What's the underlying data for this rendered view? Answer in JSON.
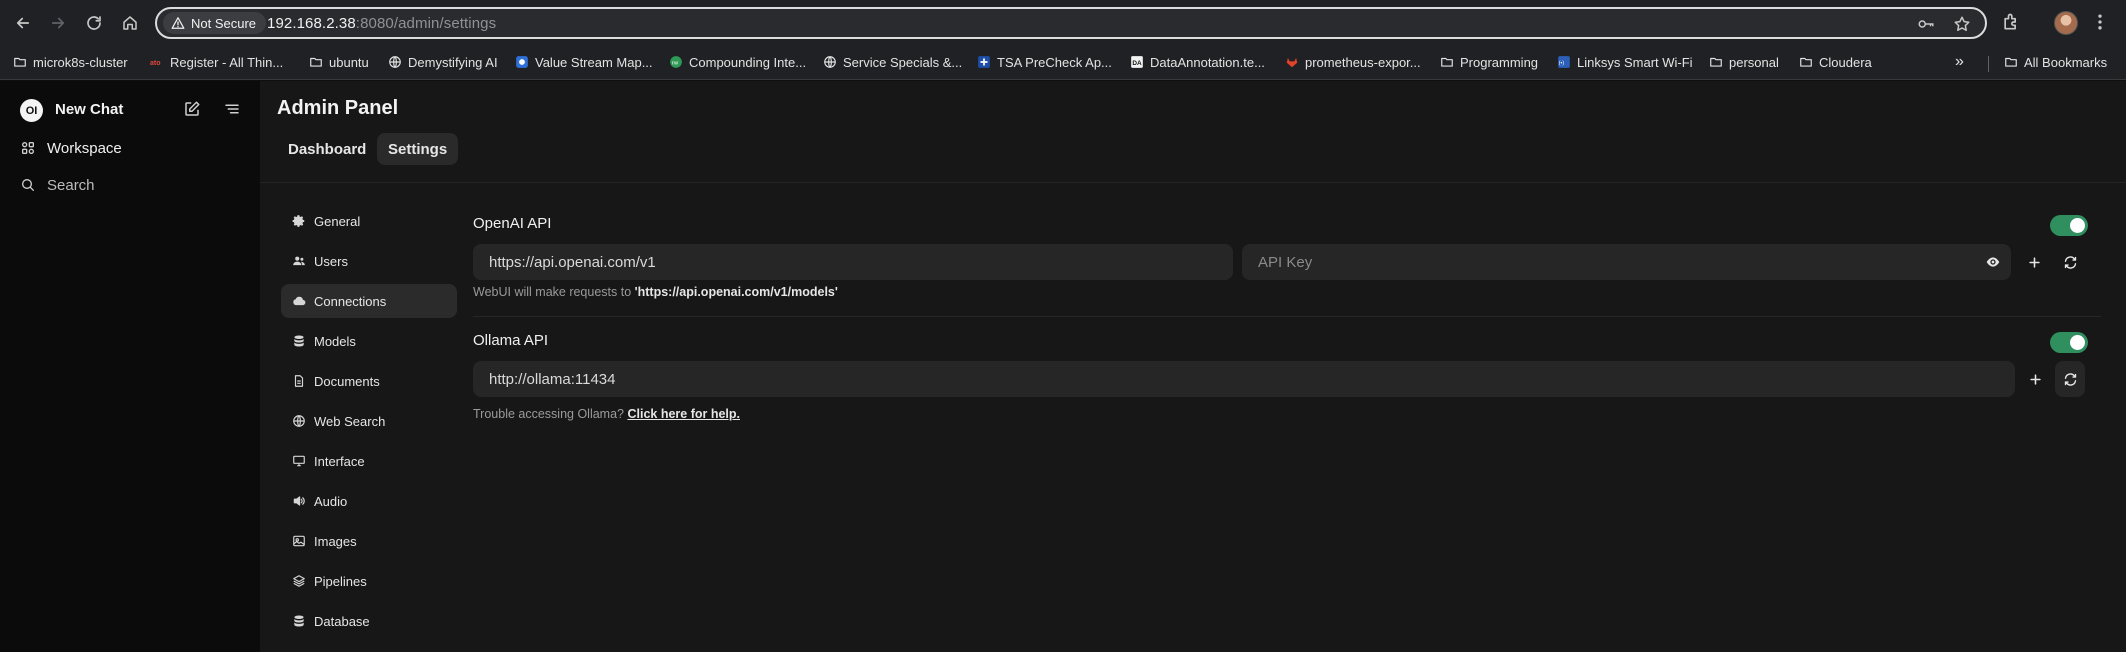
{
  "browser": {
    "security_label": "Not Secure",
    "url_host": "192.168.2.38",
    "url_rest": ":8080/admin/settings",
    "bookmarks": [
      {
        "label": "microk8s-cluster",
        "icon": "folder-icon"
      },
      {
        "label": "Register - All Thin...",
        "icon": "site-icon"
      },
      {
        "label": "ubuntu",
        "icon": "folder-icon"
      },
      {
        "label": "Demystifying AI",
        "icon": "globe-icon"
      },
      {
        "label": "Value Stream Map...",
        "icon": "site-icon"
      },
      {
        "label": "Compounding Inte...",
        "icon": "site-icon"
      },
      {
        "label": "Service Specials &...",
        "icon": "globe-icon"
      },
      {
        "label": "TSA PreCheck Ap...",
        "icon": "site-icon"
      },
      {
        "label": "DataAnnotation.te...",
        "icon": "site-icon"
      },
      {
        "label": "prometheus-expor...",
        "icon": "gitlab-icon"
      },
      {
        "label": "Programming",
        "icon": "folder-icon"
      },
      {
        "label": "Linksys Smart Wi-Fi",
        "icon": "site-icon"
      },
      {
        "label": "personal",
        "icon": "folder-icon"
      },
      {
        "label": "Cloudera",
        "icon": "folder-icon"
      }
    ],
    "more_label": "»",
    "all_bookmarks_label": "All Bookmarks"
  },
  "sidebar": {
    "logo_text": "OI",
    "new_chat_label": "New Chat",
    "workspace_label": "Workspace",
    "search_label": "Search"
  },
  "header": {
    "title": "Admin Panel",
    "tabs": [
      {
        "label": "Dashboard",
        "active": false
      },
      {
        "label": "Settings",
        "active": true
      }
    ]
  },
  "settings_nav": [
    {
      "label": "General",
      "icon": "gear-icon",
      "active": false
    },
    {
      "label": "Users",
      "icon": "users-icon",
      "active": false
    },
    {
      "label": "Connections",
      "icon": "cloud-icon",
      "active": true
    },
    {
      "label": "Models",
      "icon": "database-icon",
      "active": false
    },
    {
      "label": "Documents",
      "icon": "document-icon",
      "active": false
    },
    {
      "label": "Web Search",
      "icon": "globe-icon",
      "active": false
    },
    {
      "label": "Interface",
      "icon": "monitor-icon",
      "active": false
    },
    {
      "label": "Audio",
      "icon": "speaker-icon",
      "active": false
    },
    {
      "label": "Images",
      "icon": "image-icon",
      "active": false
    },
    {
      "label": "Pipelines",
      "icon": "layers-icon",
      "active": false
    },
    {
      "label": "Database",
      "icon": "database-icon",
      "active": false
    }
  ],
  "openai": {
    "title": "OpenAI API",
    "enabled": true,
    "base_url": "https://api.openai.com/v1",
    "api_key_placeholder": "API Key",
    "help_prefix": "WebUI will make requests to ",
    "help_url": "'https://api.openai.com/v1/models'"
  },
  "ollama": {
    "title": "Ollama API",
    "enabled": true,
    "url": "http://ollama:11434",
    "help_prefix": "Trouble accessing Ollama? ",
    "help_link": "Click here for help."
  },
  "colors": {
    "toggle_on": "#2f8f5e",
    "background": "#171717",
    "sidebar": "#0b0b0b"
  }
}
